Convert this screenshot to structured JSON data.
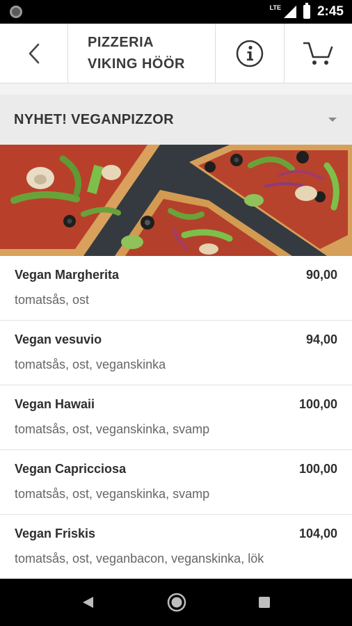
{
  "status_bar": {
    "network": "LTE",
    "time": "2:45"
  },
  "header": {
    "title_line1": "PIZZERIA",
    "title_line2": "VIKING HÖÖR"
  },
  "category": {
    "label": "NYHET! VEGANPIZZOR"
  },
  "menu_items": [
    {
      "name": "Vegan Margherita",
      "price": "90,00",
      "description": "tomatsås, ost"
    },
    {
      "name": "Vegan vesuvio",
      "price": "94,00",
      "description": "tomatsås, ost, veganskinka"
    },
    {
      "name": "Vegan Hawaii",
      "price": "100,00",
      "description": "tomatsås, ost, veganskinka, svamp"
    },
    {
      "name": "Vegan Capricciosa",
      "price": "100,00",
      "description": "tomatsås, ost, veganskinka, svamp"
    },
    {
      "name": "Vegan Friskis",
      "price": "104,00",
      "description": "tomatsås, ost, veganbacon, veganskinka, lök"
    }
  ],
  "icons": {
    "back": "chevron-left-icon",
    "info": "info-icon",
    "cart": "cart-icon",
    "expand": "caret-down-icon",
    "nav_back": "triangle-back-icon",
    "nav_home": "circle-home-icon",
    "nav_recent": "square-recent-icon"
  },
  "colors": {
    "header_bg": "#ffffff",
    "category_bg": "#ebebeb",
    "text_primary": "#2e2e2e",
    "text_secondary": "#666666"
  }
}
